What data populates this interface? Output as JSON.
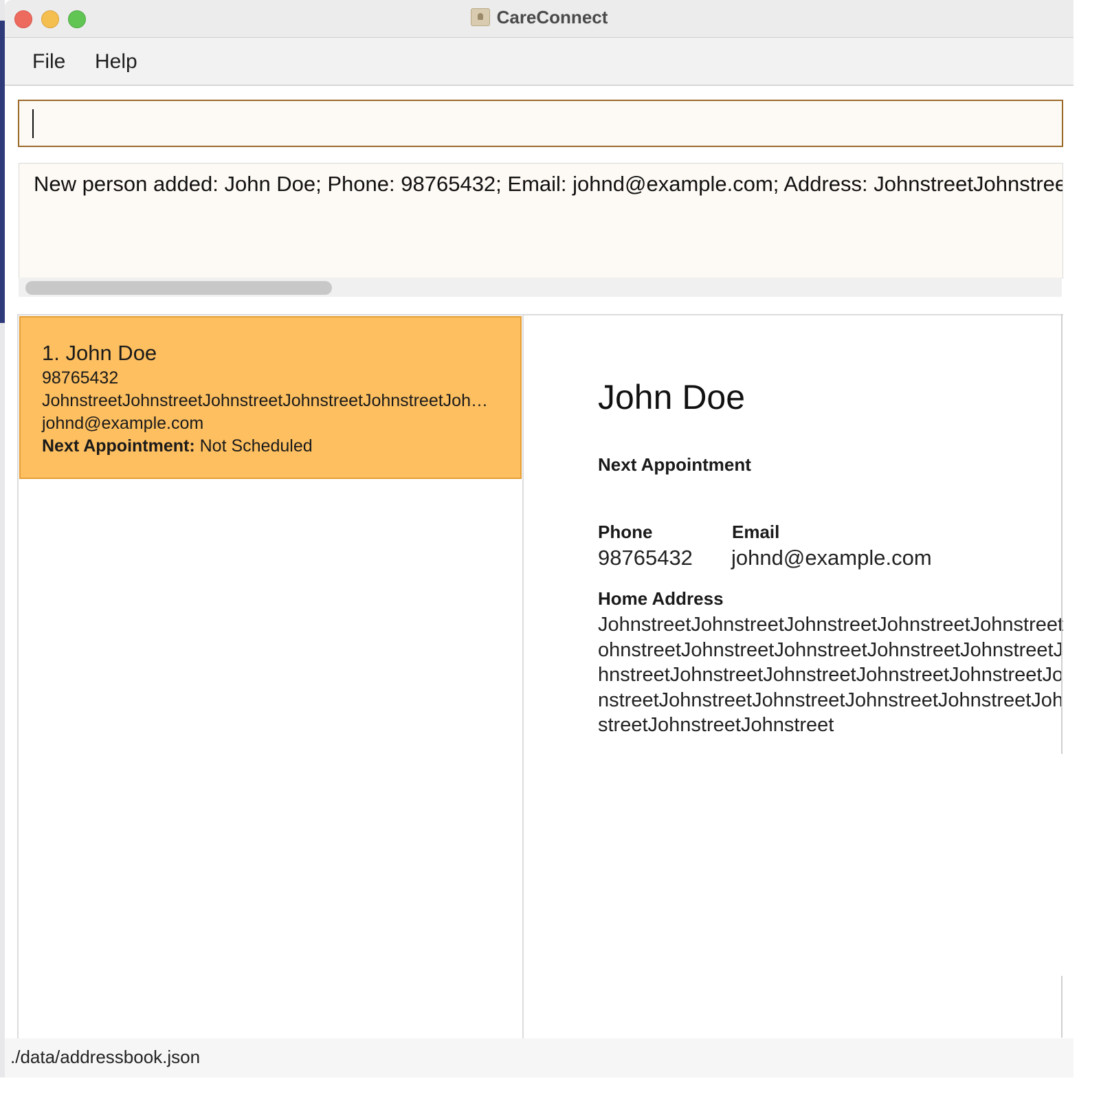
{
  "window": {
    "title": "CareConnect",
    "icon": "address-book-icon"
  },
  "menu": {
    "file": "File",
    "help": "Help"
  },
  "command": {
    "value": ""
  },
  "result": {
    "message": "New person added: John Doe; Phone: 98765432; Email: johnd@example.com; Address: JohnstreetJohnstreetJohnstreetJohnstreetJohnstreetJohnstreetJohnstreetJohnstreetJohnstreetJohnstreetJohnstreetJohnstreetJohnstreetJohnstreetJohnstreetJohnstreetJohnstreetJohnstreetJohnstreetJohnstreetJohnstreetJohnstreetJohnstreet"
  },
  "person_list": [
    {
      "index_name": "1. John Doe",
      "phone": "98765432",
      "address": "JohnstreetJohnstreetJohnstreetJohnstreetJohnstreetJohnst...",
      "email": "johnd@example.com",
      "appointment_label": "Next Appointment:",
      "appointment_value": "Not Scheduled"
    }
  ],
  "detail": {
    "name": "John Doe",
    "appointment_label": "Next Appointment",
    "phone_label": "Phone",
    "phone": "98765432",
    "email_label": "Email",
    "email": "johnd@example.com",
    "address_label": "Home Address",
    "address": "JohnstreetJohnstreetJohnstreetJohnstreetJohnstreetJohnstreetJohnstreetJohnstreetJohnstreetJohnstreetJohnstreetJohnstreetJohnstreetJohnstreetJohnstreetJohnstreetJohnstreetJohnstreetJohnstreetJohnstreetJohnstreetJohnstreetJohnstreet"
  },
  "status_bar": {
    "file_path": "./data/addressbook.json"
  },
  "colors": {
    "selected_card": "#fdbf60",
    "command_border": "#9a6a2a",
    "result_background": "#fdf9f4"
  }
}
